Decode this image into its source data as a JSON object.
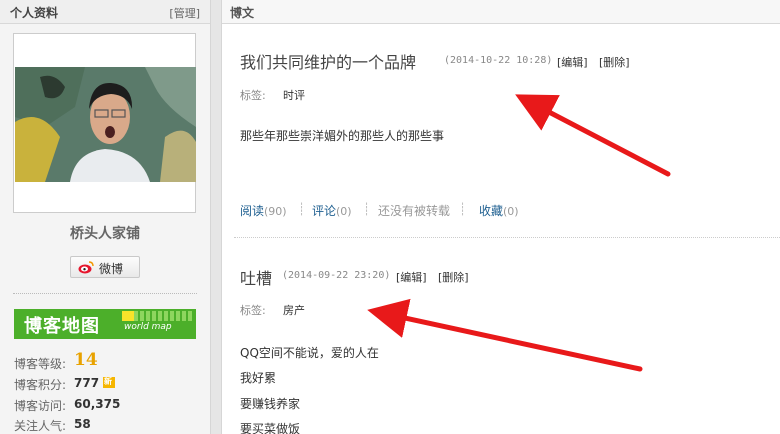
{
  "sidebar": {
    "title": "个人资料",
    "manage_label": "[管理]",
    "nickname": "桥头人家铺",
    "weibo_label": "微博",
    "blogmap": {
      "title": "博客地图",
      "sub": "world map"
    },
    "stats": {
      "level_label": "博客等级:",
      "level_value": "14",
      "score_label": "博客积分:",
      "score_value": "777",
      "new_badge": "新",
      "visit_label": "博客访问:",
      "visit_value": "60,375",
      "follow_label": "关注人气:",
      "follow_value": "58"
    }
  },
  "main": {
    "title": "博文",
    "posts": [
      {
        "title": "我们共同维护的一个品牌",
        "date": "(2014-10-22 10:28)",
        "edit_label": "[编辑]",
        "delete_label": "[删除]",
        "tag_label": "标签:",
        "tag_value": "时评",
        "body": [
          "那些年那些崇洋媚外的那些人的那些事"
        ],
        "footer": {
          "read_label": "阅读",
          "read_count": "(90)",
          "comment_label": "评论",
          "comment_count": "(0)",
          "repost_text": "还没有被转载",
          "fav_label": "收藏",
          "fav_count": "(0)",
          "sep": "┊"
        }
      },
      {
        "title": "吐槽",
        "date": "(2014-09-22 23:20)",
        "edit_label": "[编辑]",
        "delete_label": "[删除]",
        "tag_label": "标签:",
        "tag_value": "房产",
        "body": [
          "QQ空间不能说，爱的人在",
          "我好累",
          "要赚钱养家",
          "要买菜做饭"
        ]
      }
    ]
  },
  "colors": {
    "accent_link": "#1e5f90",
    "annotation_arrow": "#e8191a",
    "map_green": "#4caf2a",
    "level_gold": "#e8a200"
  }
}
